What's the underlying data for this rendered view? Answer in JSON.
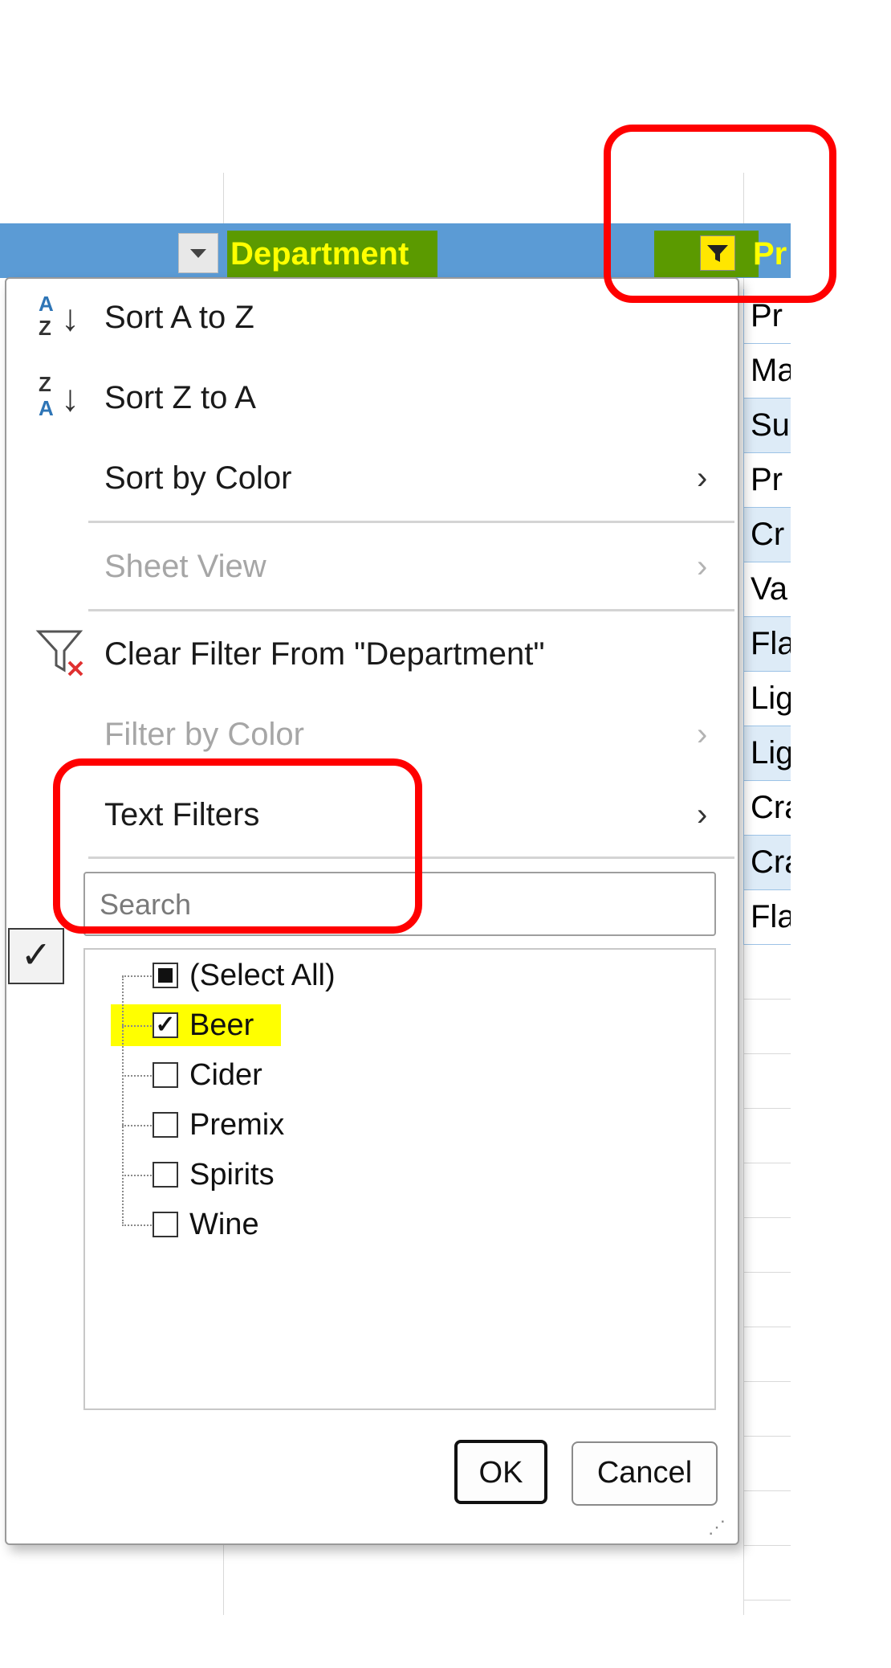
{
  "header": {
    "department_label": "Department",
    "next_column_label": "Pr"
  },
  "right_column_cells": [
    "Pr",
    "Ma",
    "Su",
    "Pr",
    "Cr",
    "Va",
    "Fla",
    "Lig",
    "Lig",
    "Cra",
    "Cra",
    "Fla"
  ],
  "selected_cell_glyph": "✓",
  "menu": {
    "sort_a_to_z": "Sort A to Z",
    "sort_z_to_a": "Sort Z to A",
    "sort_by_color": "Sort by Color",
    "sheet_view": "Sheet View",
    "clear_filter": "Clear Filter From \"Department\"",
    "filter_by_color": "Filter by Color",
    "text_filters": "Text Filters",
    "submenu_arrow": "›",
    "search_placeholder": "Search",
    "sort_icon_letters": {
      "a": "A",
      "z": "Z"
    },
    "sort_arrow": "↓"
  },
  "filter_list": [
    {
      "label": "(Select All)",
      "state": "mixed"
    },
    {
      "label": "Beer",
      "state": "checked"
    },
    {
      "label": "Cider",
      "state": "unchecked"
    },
    {
      "label": "Premix",
      "state": "unchecked"
    },
    {
      "label": "Spirits",
      "state": "unchecked"
    },
    {
      "label": "Wine",
      "state": "unchecked"
    }
  ],
  "buttons": {
    "ok": "OK",
    "cancel": "Cancel"
  },
  "colors": {
    "header_blue": "#5b9bd5",
    "header_green": "#5b9a00",
    "header_text_yellow": "#ffff00",
    "annotation_red": "#ff0000",
    "highlight_yellow": "#ffff00"
  }
}
